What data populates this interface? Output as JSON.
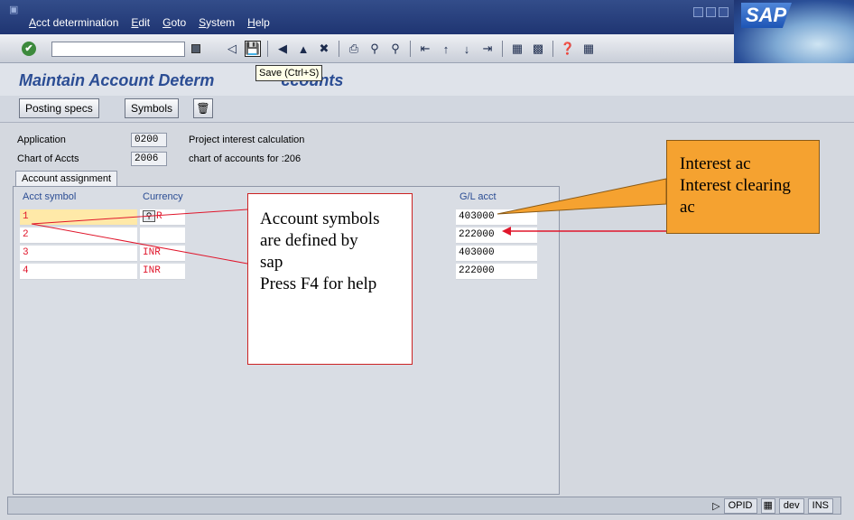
{
  "menu": {
    "items": [
      "Acct determination",
      "Edit",
      "Goto",
      "System",
      "Help"
    ]
  },
  "logo": "SAP",
  "toolbar": {
    "command_value": "",
    "icons": [
      "enter-icon",
      "back-icon",
      "save-icon",
      "back-nav-icon",
      "exit-icon",
      "cancel-icon",
      "print-icon",
      "find-icon",
      "find-next-icon",
      "first-page-icon",
      "previous-page-icon",
      "next-page-icon",
      "last-page-icon",
      "new-session-icon",
      "shortcut-icon",
      "help-icon",
      "layout-icon"
    ],
    "tooltip": "Save  (Ctrl+S)"
  },
  "page_title": "Maintain Account Determ",
  "page_title_tail": "ccounts",
  "app_toolbar": {
    "posting_specs": "Posting specs",
    "symbols": "Symbols"
  },
  "header_fields": {
    "application_label": "Application",
    "application_value": "0200",
    "application_desc": "Project interest calculation",
    "chart_label": "Chart of Accts",
    "chart_value": "2006",
    "chart_desc": "chart of accounts for :206"
  },
  "tab": "Account assignment",
  "table": {
    "columns": [
      "Acct symbol",
      "Currency",
      "G/L acct"
    ],
    "rows": [
      {
        "symbol": "1",
        "currency": "R",
        "gl": "403000"
      },
      {
        "symbol": "2",
        "currency": "",
        "gl": "222000"
      },
      {
        "symbol": "3",
        "currency": "INR",
        "gl": "403000"
      },
      {
        "symbol": "4",
        "currency": "INR",
        "gl": "222000"
      }
    ]
  },
  "callouts": {
    "symbols_note": [
      "Account symbols",
      "are defined by",
      "sap",
      "Press F4 for help"
    ],
    "gl_note": [
      "Interest ac",
      "Interest clearing",
      "ac"
    ]
  },
  "status": {
    "client": "OPID",
    "user": "dev",
    "mode": "INS"
  },
  "colors": {
    "menubar": "#1f3572",
    "title": "#2b4d94",
    "callout_orange": "#f5a230",
    "arrow_red": "#e0162b"
  }
}
